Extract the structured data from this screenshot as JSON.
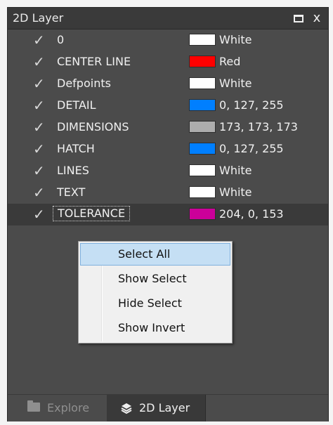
{
  "panel": {
    "title": "2D Layer",
    "restore_icon": "restore-icon",
    "close_symbol": "x"
  },
  "layers": [
    {
      "name": "0",
      "color_hex": "#ffffff",
      "color_label": "White",
      "visible": true
    },
    {
      "name": "CENTER LINE",
      "color_hex": "#ff0000",
      "color_label": "Red",
      "visible": true
    },
    {
      "name": "Defpoints",
      "color_hex": "#ffffff",
      "color_label": "White",
      "visible": true
    },
    {
      "name": "DETAIL",
      "color_hex": "#007fff",
      "color_label": "0, 127, 255",
      "visible": true
    },
    {
      "name": "DIMENSIONS",
      "color_hex": "#adadad",
      "color_label": "173, 173, 173",
      "visible": true
    },
    {
      "name": "HATCH",
      "color_hex": "#007fff",
      "color_label": "0, 127, 255",
      "visible": true
    },
    {
      "name": "LINES",
      "color_hex": "#ffffff",
      "color_label": "White",
      "visible": true
    },
    {
      "name": "TEXT",
      "color_hex": "#ffffff",
      "color_label": "White",
      "visible": true
    },
    {
      "name": "TOLERANCE",
      "color_hex": "#cc0099",
      "color_label": "204, 0, 153",
      "visible": true,
      "selected": true
    }
  ],
  "context_menu": {
    "items": [
      {
        "label": "Select All",
        "highlighted": true
      },
      {
        "label": "Show Select"
      },
      {
        "label": "Hide Select"
      },
      {
        "label": "Show Invert"
      }
    ]
  },
  "tabs": [
    {
      "label": "Explore",
      "icon": "folder-icon",
      "active": false
    },
    {
      "label": "2D Layer",
      "icon": "layer-icon",
      "active": true
    }
  ],
  "colors": {
    "panel_bg": "#4b4b4b",
    "menu_highlight": "#c5dff4"
  }
}
